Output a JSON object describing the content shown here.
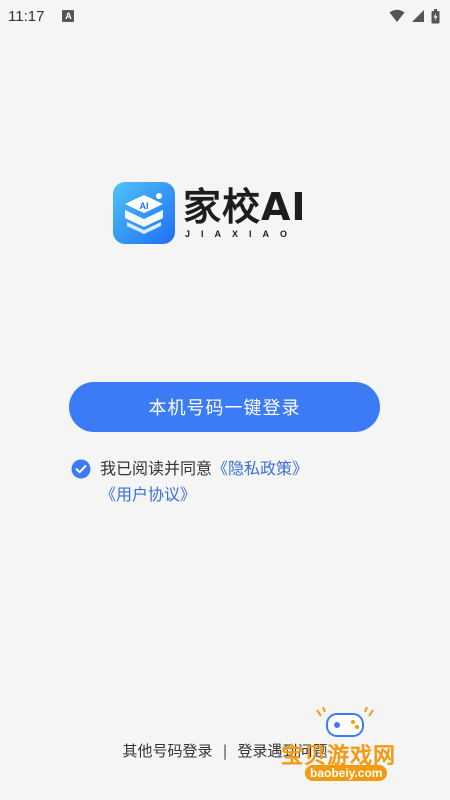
{
  "status_bar": {
    "time": "11:17",
    "notification_glyph": "A",
    "icons": [
      "wifi-icon",
      "signal-icon",
      "battery-icon"
    ]
  },
  "logo": {
    "icon": "book-ai-logo-icon",
    "title": "家校AI",
    "subtitle": "JIAXIAO"
  },
  "login": {
    "one_click_label": "本机号码一键登录"
  },
  "agreement": {
    "checked": true,
    "prefix": "我已阅读并同意",
    "privacy_link": "《隐私政策》",
    "terms_link": "《用户协议》"
  },
  "bottom": {
    "other_login": "其他号码登录",
    "separator": "|",
    "problem_label": "登录遇到问题"
  },
  "watermark": {
    "title": "宝贝游戏网",
    "url": "baobeiy.com"
  },
  "colors": {
    "accent": "#3b7bf6",
    "link": "#3b6fd6",
    "background": "#f5f5f5",
    "watermark": "#f39a10"
  }
}
